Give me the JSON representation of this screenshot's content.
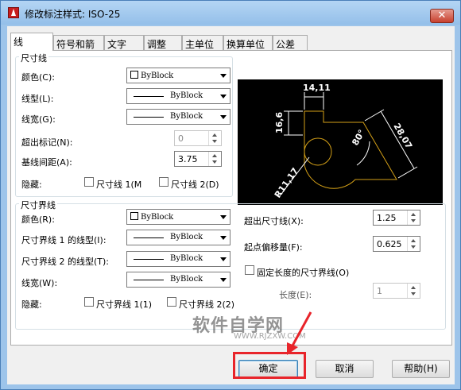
{
  "window": {
    "title": "修改标注样式: ISO-25",
    "close_glyph": "✕"
  },
  "tabs": [
    "线",
    "符号和箭头",
    "文字",
    "调整",
    "主单位",
    "换算单位",
    "公差"
  ],
  "dim_lines": {
    "group_label": "尺寸线",
    "color_label": "颜色(C):",
    "color_value": "ByBlock",
    "linetype_label": "线型(L):",
    "linetype_value": "ByBlock",
    "lineweight_label": "线宽(G):",
    "lineweight_value": "ByBlock",
    "extend_ticks_label": "超出标记(N):",
    "extend_ticks_value": "0",
    "baseline_spacing_label": "基线间距(A):",
    "baseline_spacing_value": "3.75",
    "suppress_label": "隐藏:",
    "suppress_1": "尺寸线 1(M",
    "suppress_2": "尺寸线 2(D)"
  },
  "ext_lines": {
    "group_label": "尺寸界线",
    "color_label": "颜色(R):",
    "color_value": "ByBlock",
    "linetype1_label": "尺寸界线 1 的线型(I):",
    "linetype1_value": "ByBlock",
    "linetype2_label": "尺寸界线 2 的线型(T):",
    "linetype2_value": "ByBlock",
    "lineweight_label": "线宽(W):",
    "lineweight_value": "ByBlock",
    "suppress_label": "隐藏:",
    "suppress_1": "尺寸界线 1(1)",
    "suppress_2": "尺寸界线 2(2)",
    "extend_label": "超出尺寸线(X):",
    "extend_value": "1.25",
    "offset_label": "起点偏移量(F):",
    "offset_value": "0.625",
    "fixed_label": "固定长度的尺寸界线(O)",
    "length_label": "长度(E):",
    "length_value": "1"
  },
  "preview": {
    "dim_top": "14,11",
    "dim_left": "16,6",
    "dim_right": "28,07",
    "dim_angle": "80°",
    "dim_radius": "R11,17",
    "line_color": "#d4a017"
  },
  "buttons": {
    "ok": "确定",
    "cancel": "取消",
    "help": "帮助(H)"
  },
  "watermark": {
    "text": "软件自学网",
    "url": "WWW.RJZXW.COM"
  },
  "accent": {
    "highlight": "#e8242a"
  }
}
